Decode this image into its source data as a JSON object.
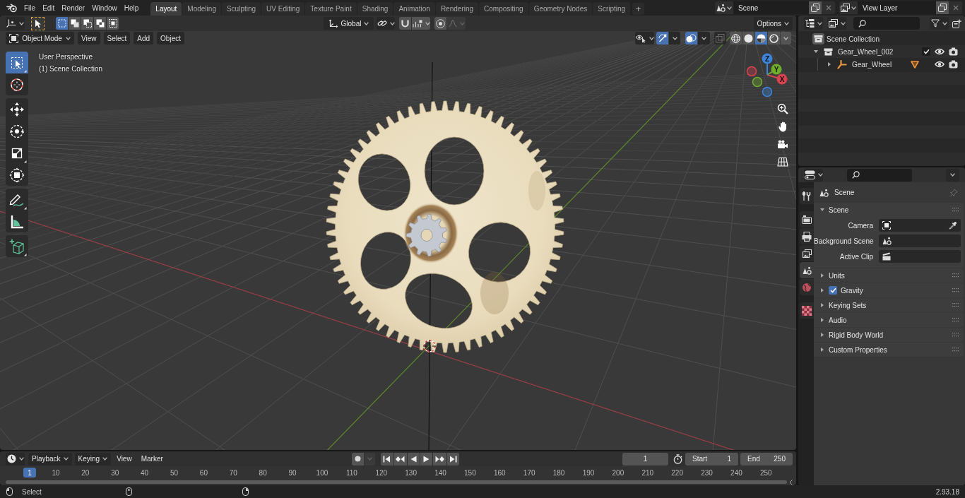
{
  "topbar": {
    "menus": [
      "File",
      "Edit",
      "Render",
      "Window",
      "Help"
    ],
    "workspaces": [
      {
        "label": "Layout",
        "selected": true
      },
      {
        "label": "Modeling",
        "selected": false
      },
      {
        "label": "Sculpting",
        "selected": false
      },
      {
        "label": "UV Editing",
        "selected": false
      },
      {
        "label": "Texture Paint",
        "selected": false
      },
      {
        "label": "Shading",
        "selected": false
      },
      {
        "label": "Animation",
        "selected": false
      },
      {
        "label": "Rendering",
        "selected": false
      },
      {
        "label": "Compositing",
        "selected": false
      },
      {
        "label": "Geometry Nodes",
        "selected": false
      },
      {
        "label": "Scripting",
        "selected": false
      }
    ],
    "add_workspace": "+",
    "scene": "Scene",
    "view_layer": "View Layer"
  },
  "viewport": {
    "header": {
      "select_modes": [
        {
          "kind": "set",
          "selected": true
        },
        {
          "kind": "extend",
          "selected": false
        },
        {
          "kind": "subtract",
          "selected": false
        },
        {
          "kind": "invert",
          "selected": false
        },
        {
          "kind": "intersect",
          "selected": false
        }
      ],
      "orientation": "Global",
      "snap_on": false,
      "proportional_on": false,
      "options": "Options",
      "mode": "Object Mode",
      "menus": [
        "View",
        "Select",
        "Add",
        "Object"
      ],
      "gizmos_on": true,
      "overlays_on": true,
      "xray_on": false,
      "shading": [
        {
          "kind": "wireframe",
          "selected": false
        },
        {
          "kind": "solid",
          "selected": false
        },
        {
          "kind": "material",
          "selected": true
        },
        {
          "kind": "rendered",
          "selected": false
        }
      ]
    },
    "info": [
      "User Perspective",
      "(1) Scene Collection"
    ],
    "tool_groups": [
      [
        {
          "kind": "select_box",
          "selected": true
        },
        {
          "kind": "cursor",
          "selected": false
        }
      ],
      [
        {
          "kind": "move",
          "selected": false
        },
        {
          "kind": "rotate",
          "selected": false
        },
        {
          "kind": "scale",
          "selected": false
        },
        {
          "kind": "transform",
          "selected": false
        }
      ],
      [
        {
          "kind": "annotate",
          "selected": false
        },
        {
          "kind": "measure",
          "selected": false
        }
      ],
      [
        {
          "kind": "add_cube",
          "selected": false
        }
      ]
    ],
    "gizmo_axes": [
      {
        "label": "X",
        "color": "#d8434f"
      },
      {
        "label": "Y",
        "color": "#6fae2c"
      },
      {
        "label": "Z",
        "color": "#3b84d8"
      }
    ]
  },
  "outliner": {
    "tree": [
      {
        "label": "Scene Collection",
        "kind": "scene_collection",
        "children": [
          {
            "label": "Gear_Wheel_002",
            "kind": "collection",
            "expanded": true,
            "checkbox": {
              "checked": true
            },
            "visible": true,
            "renderable": true,
            "children": [
              {
                "label": "Gear_Wheel",
                "kind": "empty",
                "expanded": false,
                "data_icons": [
                  {
                    "kind": "mesh"
                  }
                ],
                "visible": true,
                "renderable": true
              }
            ]
          }
        ]
      }
    ]
  },
  "properties": {
    "tab_groups": [
      [
        {
          "kind": "tool",
          "selected": false
        }
      ],
      [
        {
          "kind": "render",
          "selected": false
        },
        {
          "kind": "output",
          "selected": false
        },
        {
          "kind": "view_layer",
          "selected": false
        },
        {
          "kind": "scene",
          "selected": true
        },
        {
          "kind": "world",
          "selected": false
        }
      ],
      [
        {
          "kind": "texture",
          "selected": false
        }
      ]
    ],
    "context": "Scene",
    "panels": [
      {
        "title": "Scene",
        "expanded": true,
        "fields": [
          {
            "label": "Camera",
            "kind": "camera",
            "eyedropper": true
          },
          {
            "label": "Background Scene",
            "kind": "scene"
          },
          {
            "label": "Active Clip",
            "kind": "clip"
          }
        ]
      },
      {
        "title": "Units",
        "expanded": false
      },
      {
        "title": "Gravity",
        "expanded": false,
        "checkbox": {
          "checked": true
        }
      },
      {
        "title": "Keying Sets",
        "expanded": false
      },
      {
        "title": "Audio",
        "expanded": false
      },
      {
        "title": "Rigid Body World",
        "expanded": false
      },
      {
        "title": "Custom Properties",
        "expanded": false
      }
    ]
  },
  "timeline": {
    "menus": [
      {
        "label": "Playback",
        "kind": "dropdown"
      },
      {
        "label": "Keying",
        "kind": "dropdown"
      },
      {
        "label": "View",
        "kind": "menu"
      },
      {
        "label": "Marker",
        "kind": "menu"
      }
    ],
    "auto_key_on": false,
    "current_frame": "1",
    "start": {
      "label": "Start",
      "value": "1"
    },
    "end": {
      "label": "End",
      "value": "250"
    },
    "ruler": {
      "current": "1",
      "labels": [
        "10",
        "20",
        "30",
        "40",
        "50",
        "60",
        "70",
        "80",
        "90",
        "100",
        "110",
        "120",
        "130",
        "140",
        "150",
        "160",
        "170",
        "180",
        "190",
        "200",
        "210",
        "220",
        "230",
        "240",
        "250"
      ]
    }
  },
  "status_bar": {
    "hint": "Select",
    "version": "2.93.18"
  }
}
